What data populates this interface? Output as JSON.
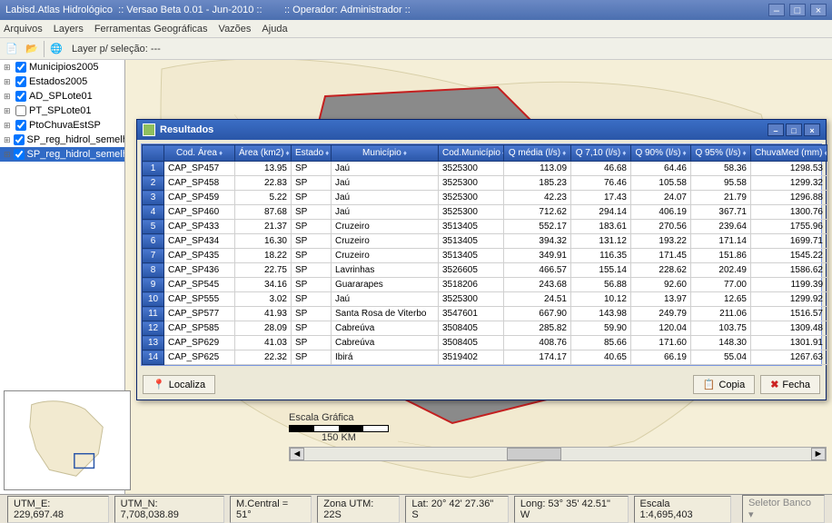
{
  "title_parts": {
    "app": "Labisd.Atlas Hidrológico",
    "version": ":: Versao Beta 0.01 - Jun-2010 ::",
    "operator_label": ":: Operador:",
    "operator_value": "Administrador ::"
  },
  "menu": [
    "Arquivos",
    "Layers",
    "Ferramentas Geográficas",
    "Vazões",
    "Ajuda"
  ],
  "toolbar_label": "Layer p/ seleção: ---",
  "layers": [
    {
      "label": "Municipios2005",
      "checked": true
    },
    {
      "label": "Estados2005",
      "checked": true
    },
    {
      "label": "AD_SPLote01",
      "checked": true
    },
    {
      "label": "PT_SPLote01",
      "checked": false
    },
    {
      "label": "PtoChuvaEstSP",
      "checked": true
    },
    {
      "label": "SP_reg_hidrol_semelh_A",
      "checked": true
    },
    {
      "label": "SP_reg_hidrol_semelh_X",
      "checked": true,
      "selected": true
    }
  ],
  "dialog": {
    "title": "Resultados",
    "columns": [
      "Cod. Área",
      "Área (km2)",
      "Estado",
      "Município",
      "Cod.Município",
      "Q média (l/s)",
      "Q 7,10 (l/s)",
      "Q 90% (l/s)",
      "Q 95% (l/s)",
      "ChuvaMed (mm)"
    ],
    "rows": [
      [
        "CAP_SP457",
        "13.95",
        "SP",
        "Jaú",
        "3525300",
        "113.09",
        "46.68",
        "64.46",
        "58.36",
        "1298.53"
      ],
      [
        "CAP_SP458",
        "22.83",
        "SP",
        "Jaú",
        "3525300",
        "185.23",
        "76.46",
        "105.58",
        "95.58",
        "1299.32"
      ],
      [
        "CAP_SP459",
        "5.22",
        "SP",
        "Jaú",
        "3525300",
        "42.23",
        "17.43",
        "24.07",
        "21.79",
        "1296.88"
      ],
      [
        "CAP_SP460",
        "87.68",
        "SP",
        "Jaú",
        "3525300",
        "712.62",
        "294.14",
        "406.19",
        "367.71",
        "1300.76"
      ],
      [
        "CAP_SP433",
        "21.37",
        "SP",
        "Cruzeiro",
        "3513405",
        "552.17",
        "183.61",
        "270.56",
        "239.64",
        "1755.96"
      ],
      [
        "CAP_SP434",
        "16.30",
        "SP",
        "Cruzeiro",
        "3513405",
        "394.32",
        "131.12",
        "193.22",
        "171.14",
        "1699.71"
      ],
      [
        "CAP_SP435",
        "18.22",
        "SP",
        "Cruzeiro",
        "3513405",
        "349.91",
        "116.35",
        "171.45",
        "151.86",
        "1545.22"
      ],
      [
        "CAP_SP436",
        "22.75",
        "SP",
        "Lavrinhas",
        "3526605",
        "466.57",
        "155.14",
        "228.62",
        "202.49",
        "1586.62"
      ],
      [
        "CAP_SP545",
        "34.16",
        "SP",
        "Guararapes",
        "3518206",
        "243.68",
        "56.88",
        "92.60",
        "77.00",
        "1199.39"
      ],
      [
        "CAP_SP555",
        "3.02",
        "SP",
        "Jaú",
        "3525300",
        "24.51",
        "10.12",
        "13.97",
        "12.65",
        "1299.92"
      ],
      [
        "CAP_SP577",
        "41.93",
        "SP",
        "Santa Rosa de Viterbo",
        "3547601",
        "667.90",
        "143.98",
        "249.79",
        "211.06",
        "1516.57"
      ],
      [
        "CAP_SP585",
        "28.09",
        "SP",
        "Cabreúva",
        "3508405",
        "285.82",
        "59.90",
        "120.04",
        "103.75",
        "1309.48"
      ],
      [
        "CAP_SP629",
        "41.03",
        "SP",
        "Cabreúva",
        "3508405",
        "408.76",
        "85.66",
        "171.60",
        "148.30",
        "1301.91"
      ],
      [
        "CAP_SP625",
        "22.32",
        "SP",
        "Ibirá",
        "3519402",
        "174.17",
        "40.65",
        "66.19",
        "55.04",
        "1267.63"
      ]
    ],
    "btn_localiza": "Localiza",
    "btn_copia": "Copia",
    "btn_fecha": "Fecha"
  },
  "scale_label": "Escala Gráfica",
  "scale_value": "150 KM",
  "status": {
    "utm_e": "UTM_E: 229,697.48",
    "utm_n": "UTM_N: 7,708,038.89",
    "mcentral": "M.Central = 51°",
    "zona": "Zona UTM: 22S",
    "lat": "Lat: 20° 42' 27.36\" S",
    "long": "Long: 53° 35' 42.51\" W",
    "escala": "Escala 1:4,695,403",
    "seletor": "Seletor Banco ▾"
  }
}
